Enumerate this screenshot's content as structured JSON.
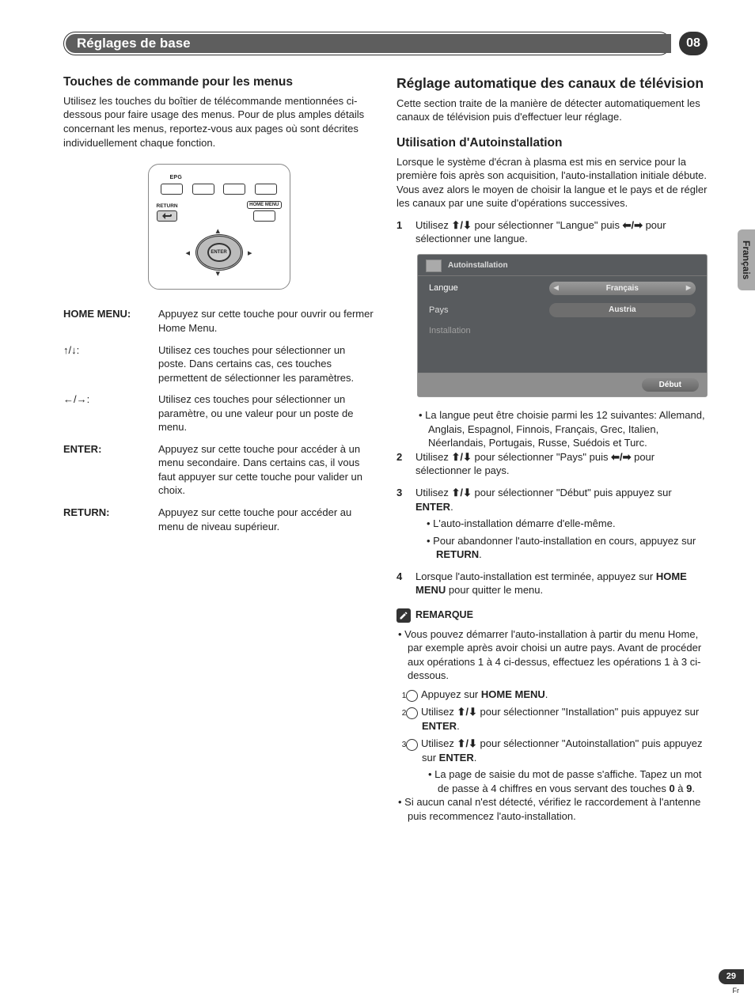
{
  "chapter": {
    "title": "Réglages de base",
    "number": "08"
  },
  "sideTab": "Français",
  "left": {
    "h2": "Touches de commande pour les menus",
    "intro": "Utilisez les touches du boîtier de télécommande mentionnées ci-dessous pour faire usage des menus. Pour de plus amples détails concernant les menus, reportez-vous aux pages où sont décrites individuellement chaque fonction.",
    "remote": {
      "epg": "EPG",
      "return": "RETURN",
      "home": "HOME MENU",
      "enter": "ENTER"
    },
    "keys": {
      "homeMenu": {
        "term": "HOME MENU",
        "desc": "Appuyez sur cette touche pour ouvrir ou fermer Home Menu."
      },
      "upDown": {
        "term": "↑/↓:",
        "desc": "Utilisez ces touches pour sélectionner un poste. Dans certains cas, ces touches permettent de sélectionner les paramètres."
      },
      "leftRight": {
        "term": "←/→:",
        "desc": "Utilisez ces touches pour sélectionner un paramètre, ou une valeur pour un poste de menu."
      },
      "enter": {
        "term": "ENTER",
        "desc": "Appuyez sur cette touche pour accéder à un menu secondaire. Dans certains cas, il vous faut appuyer sur cette touche pour valider un choix."
      },
      "return": {
        "term": "RETURN",
        "desc": "Appuyez sur cette touche pour accéder au menu de niveau supérieur."
      }
    }
  },
  "right": {
    "h1": "Réglage automatique des canaux de télévision",
    "intro": "Cette section traite de la manière de détecter automatiquement les canaux de télévision puis d'effectuer leur réglage.",
    "h2": "Utilisation d'Autoinstallation",
    "p2": "Lorsque le système d'écran à plasma est mis en service pour la première fois après son acquisition, l'auto-installation initiale débute. Vous avez alors le moyen de choisir la langue et le pays et de régler les canaux par une suite d'opérations successives.",
    "step1a": "Utilisez ",
    "step1b": " pour sélectionner \"Langue\" puis ",
    "step1c": " pour sélectionner une langue.",
    "screen": {
      "title": "Autoinstallation",
      "rowLang": "Langue",
      "valLang": "Français",
      "rowPays": "Pays",
      "valPays": "Austria",
      "rowInstall": "Installation",
      "btn": "Début"
    },
    "step1Note": "La langue peut être choisie parmi les 12 suivantes: Allemand, Anglais, Espagnol, Finnois, Français, Grec, Italien, Néerlandais, Portugais, Russe, Suédois et Turc.",
    "step2a": "Utilisez ",
    "step2b": " pour sélectionner \"Pays\" puis ",
    "step2c": " pour sélectionner le pays.",
    "step3a": "Utilisez ",
    "step3b": " pour sélectionner \"Début\" puis appuyez sur ",
    "step3c": ".",
    "step3s1": "L'auto-installation démarre d'elle-même.",
    "step3s2a": "Pour abandonner l'auto-installation en cours, appuyez sur ",
    "step3s2b": ".",
    "step4a": "Lorsque l'auto-installation est terminée, appuyez sur ",
    "step4b": " pour quitter le menu.",
    "kw": {
      "enter": "ENTER",
      "return": "RETURN",
      "home": "HOME MENU"
    },
    "noteTitle": "REMARQUE",
    "note1": "Vous pouvez démarrer l'auto-installation à partir du menu Home, par exemple après avoir choisi un autre pays. Avant de procéder aux opérations 1 à 4 ci-dessus, effectuez les opérations 1 à 3 ci-dessous.",
    "sub1a": "Appuyez sur ",
    "sub1b": ".",
    "sub2a": "Utilisez ",
    "sub2b": " pour sélectionner \"Installation\" puis appuyez sur ",
    "sub2c": ".",
    "sub3a": "Utilisez ",
    "sub3b": " pour sélectionner \"Autoinstallation\" puis appuyez sur ",
    "sub3c": ".",
    "sub3note_a": "La page de saisie du mot de passe s'affiche. Tapez un mot de passe à 4 chiffres en vous servant des touches ",
    "sub3note_b": " à ",
    "sub3note_c": ".",
    "kw0": "0",
    "kw9": "9",
    "note2": "Si aucun canal n'est détecté, vérifiez le raccordement à l'antenne puis recommencez l'auto-installation."
  },
  "footer": {
    "page": "29",
    "sub": "Fr"
  },
  "glyph": {
    "ud": "⬆/⬇",
    "lr": "⬅/➡"
  }
}
